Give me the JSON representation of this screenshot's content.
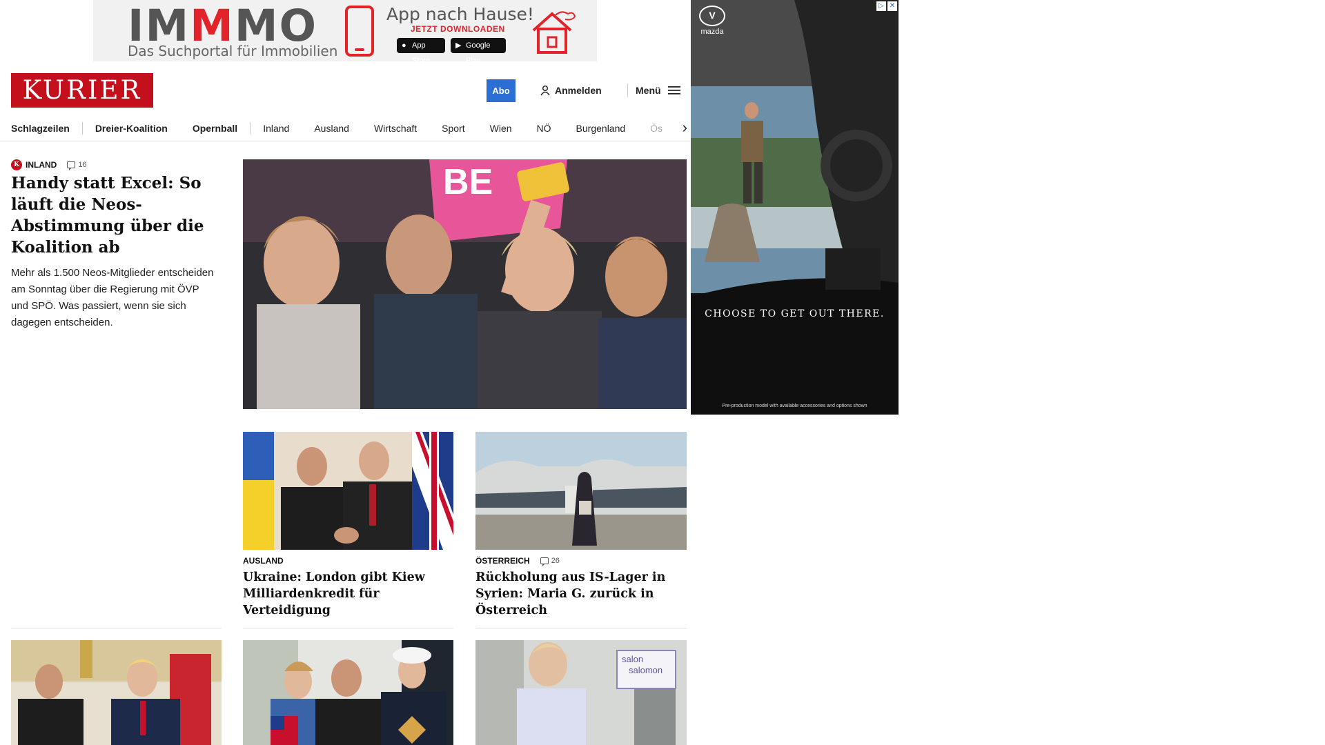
{
  "top_ad": {
    "brand_part1": "IM",
    "brand_part2": "M",
    "brand_part3": "MO",
    "tagline": "Das Suchportal für Immobilien",
    "cta_title": "App nach Hause!",
    "cta_sub": "JETZT DOWNLOADEN",
    "store_apple": "App Store",
    "store_google": "Google Play",
    "accent_color": "#e2232a"
  },
  "header": {
    "logo": "KURIER",
    "abo_label": "Abo",
    "login_label": "Anmelden",
    "menu_label": "Menü",
    "brand_color": "#c4101c",
    "abo_color": "#2b6ed4"
  },
  "nav": {
    "items": [
      "Schlagzeilen",
      "Dreier-Koalition",
      "Opernball",
      "Inland",
      "Ausland",
      "Wirtschaft",
      "Sport",
      "Wien",
      "NÖ",
      "Burgenland",
      "Ös"
    ]
  },
  "lead": {
    "kicker": "INLAND",
    "comments": "16",
    "title": "Handy statt Excel: So läuft die Neos-Abstimmung über die Koalition ab",
    "teaser": "Mehr als 1.500 Neos-Mitglieder entscheiden am Sonntag über die Regierung mit ÖVP und SPÖ. Was passiert, wenn sie sich dagegen entscheiden.",
    "photo_text": "BE"
  },
  "stories": [
    {
      "kicker": "AUSLAND",
      "comments": "",
      "title": "Ukraine: London gibt Kiew Milliardenkredit für Verteidigung"
    },
    {
      "kicker": "ÖSTERREICH",
      "comments": "26",
      "title": "Rückholung aus IS-Lager in Syrien: Maria G. zurück in Österreich"
    }
  ],
  "bottom_row": {
    "salon_text1": "salon",
    "salon_text2": "salomon"
  },
  "side_ad": {
    "brand": "mazda",
    "slogan": "CHOOSE TO GET OUT THERE.",
    "fine_print": "Pre-production model with available accessories and options shown",
    "adchoice_play": "▷",
    "adchoice_close": "✕"
  }
}
